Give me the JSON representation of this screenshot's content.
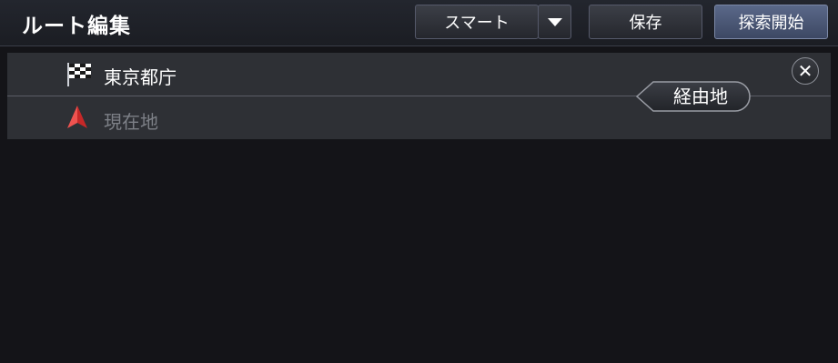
{
  "header": {
    "title": "ルート編集",
    "mode_button_label": "スマート",
    "save_button_label": "保存",
    "search_button_label": "探索開始"
  },
  "route": {
    "destination": {
      "name": "東京都庁",
      "icon": "checkered-flag-icon"
    },
    "origin": {
      "name": "現在地",
      "icon": "current-location-arrow-icon"
    },
    "via_button_label": "経由地",
    "close_icon": "close-icon"
  },
  "colors": {
    "background": "#141418",
    "panel": "#2e3035",
    "origin_text": "#7d8087",
    "location_arrow": "#e53935",
    "search_button": "#4a5675"
  }
}
